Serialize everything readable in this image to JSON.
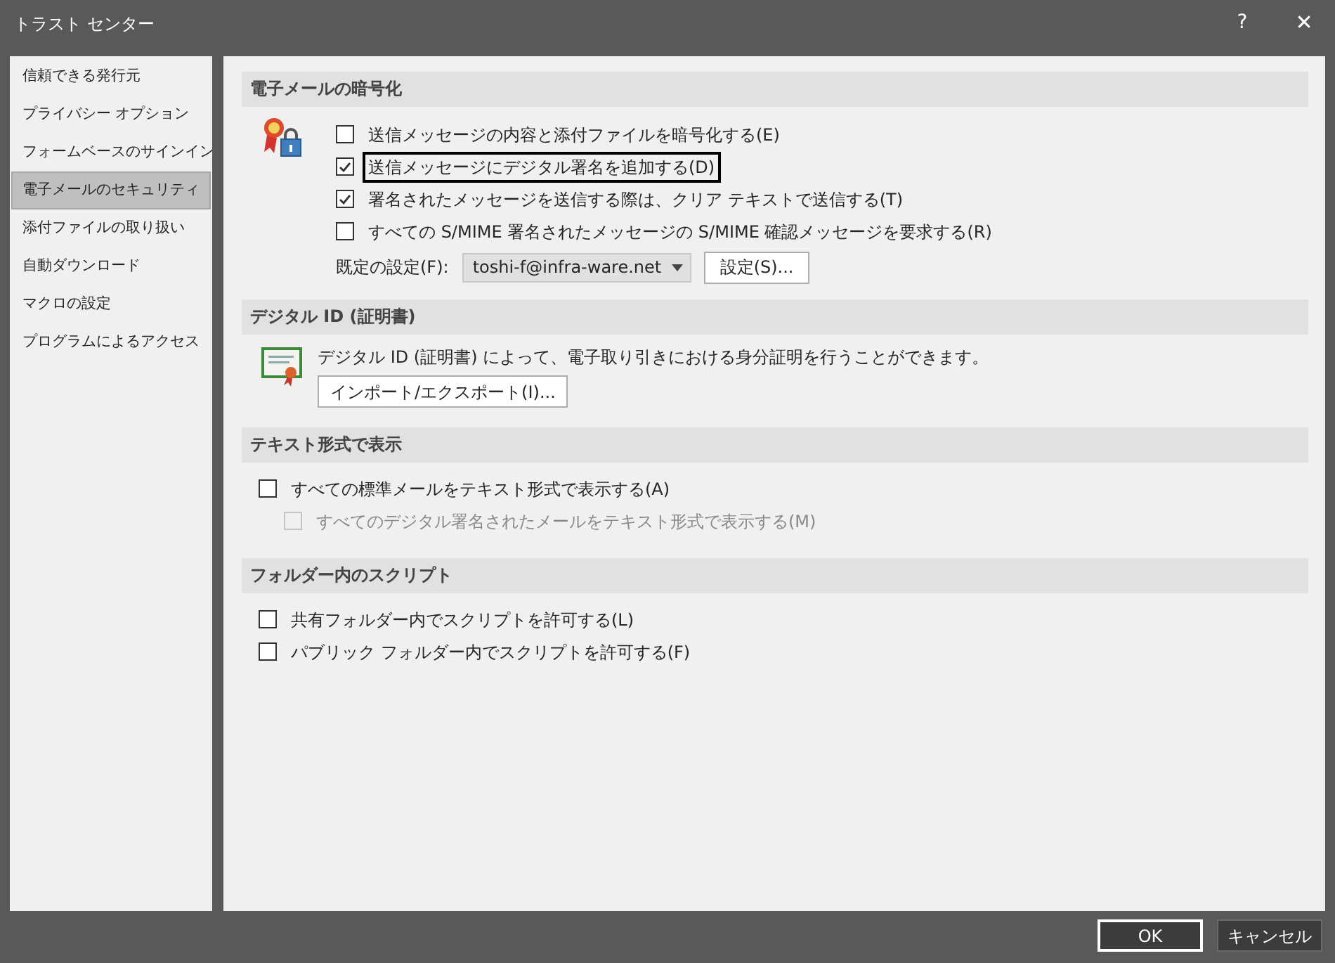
{
  "window": {
    "title": "トラスト センター",
    "help": "?",
    "close": "✕"
  },
  "sidebar": {
    "items": [
      {
        "label": "信頼できる発行元",
        "selected": false
      },
      {
        "label": "プライバシー オプション",
        "selected": false
      },
      {
        "label": "フォームベースのサインイン",
        "selected": false
      },
      {
        "label": "電子メールのセキュリティ",
        "selected": true
      },
      {
        "label": "添付ファイルの取り扱い",
        "selected": false
      },
      {
        "label": "自動ダウンロード",
        "selected": false
      },
      {
        "label": "マクロの設定",
        "selected": false
      },
      {
        "label": "プログラムによるアクセス",
        "selected": false
      }
    ]
  },
  "sections": [
    {
      "kind": "encryption",
      "title": "電子メールの暗号化",
      "options": [
        {
          "label": "送信メッセージの内容と添付ファイルを暗号化する(E)",
          "checked": false,
          "focused": false
        },
        {
          "label": "送信メッセージにデジタル署名を追加する(D)",
          "checked": true,
          "focused": true
        },
        {
          "label": "署名されたメッセージを送信する際は、クリア テキストで送信する(T)",
          "checked": true,
          "focused": false
        },
        {
          "label": "すべての S/MIME 署名されたメッセージの S/MIME 確認メッセージを要求する(R)",
          "checked": false,
          "focused": false
        }
      ],
      "default_setting": {
        "label": "既定の設定(F):",
        "value": "toshi-f@infra-ware.net",
        "button": "設定(S)..."
      }
    },
    {
      "kind": "digital_id",
      "title": "デジタル ID (証明書)",
      "description": "デジタル ID (証明書) によって、電子取り引きにおける身分証明を行うことができます。",
      "button": "インポート/エクスポート(I)..."
    },
    {
      "kind": "checklist",
      "title": "テキスト形式で表示",
      "options": [
        {
          "label": "すべての標準メールをテキスト形式で表示する(A)",
          "checked": false,
          "disabled": false,
          "children": [
            {
              "label": "すべてのデジタル署名されたメールをテキスト形式で表示する(M)",
              "checked": false,
              "disabled": true
            }
          ]
        }
      ]
    },
    {
      "kind": "checklist",
      "title": "フォルダー内のスクリプト",
      "options": [
        {
          "label": "共有フォルダー内でスクリプトを許可する(L)",
          "checked": false,
          "disabled": false
        },
        {
          "label": "パブリック フォルダー内でスクリプトを許可する(F)",
          "checked": false,
          "disabled": false
        }
      ]
    }
  ],
  "buttons": [
    {
      "label": "OK",
      "default": true
    },
    {
      "label": "キャンセル",
      "default": false
    }
  ]
}
